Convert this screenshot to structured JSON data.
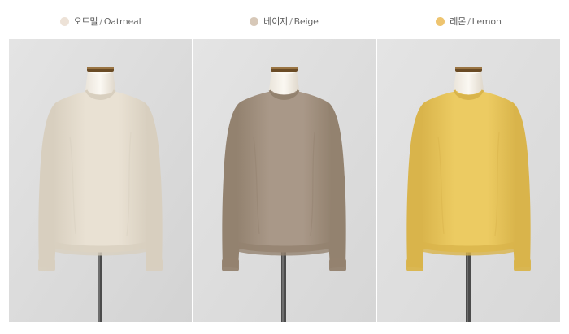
{
  "products": [
    {
      "name_ko": "오트밀",
      "name_en": "Oatmeal",
      "swatch_color": "#ede2d7",
      "sweater_color": "#e9e1d3",
      "sweater_shade": "#d8cfbf",
      "background_color": "#d3d3d3"
    },
    {
      "name_ko": "베이지",
      "name_en": "Beige",
      "swatch_color": "#d7c8b8",
      "sweater_color": "#a99888",
      "sweater_shade": "#93826f",
      "background_color": "#d6d6d6"
    },
    {
      "name_ko": "레몬",
      "name_en": "Lemon",
      "swatch_color": "#eec46f",
      "sweater_color": "#eccb62",
      "sweater_shade": "#d9b44b",
      "background_color": "#d8d8d8"
    }
  ],
  "separator": "/"
}
